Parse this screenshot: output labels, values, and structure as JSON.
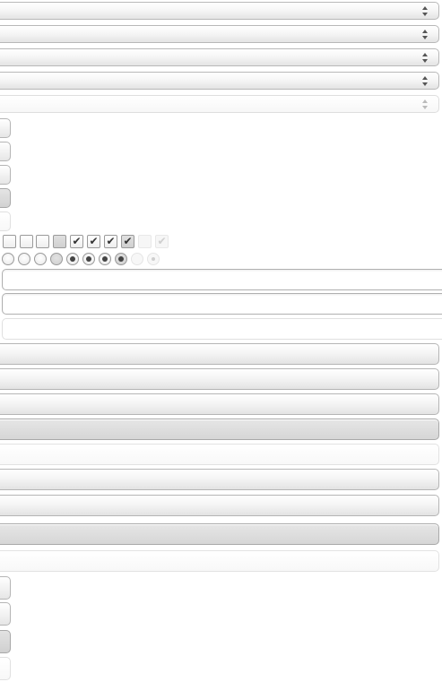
{
  "selects": [
    {
      "state": "normal"
    },
    {
      "state": "normal"
    },
    {
      "state": "pressed"
    },
    {
      "state": "normal"
    },
    {
      "state": "disabled"
    }
  ],
  "stub_buttons": [
    {
      "state": "normal"
    },
    {
      "state": "normal"
    },
    {
      "state": "normal"
    },
    {
      "state": "pressed"
    },
    {
      "state": "disabled"
    }
  ],
  "checkboxes": [
    {
      "checked": false,
      "state": "normal"
    },
    {
      "checked": false,
      "state": "normal"
    },
    {
      "checked": false,
      "state": "normal"
    },
    {
      "checked": false,
      "state": "pressed"
    },
    {
      "checked": true,
      "state": "normal"
    },
    {
      "checked": true,
      "state": "normal"
    },
    {
      "checked": true,
      "state": "normal"
    },
    {
      "checked": true,
      "state": "pressed"
    },
    {
      "checked": false,
      "state": "disabled"
    },
    {
      "checked": true,
      "state": "disabled"
    }
  ],
  "check_glyph": "✔",
  "radios": [
    {
      "checked": false,
      "state": "normal"
    },
    {
      "checked": false,
      "state": "normal"
    },
    {
      "checked": false,
      "state": "normal"
    },
    {
      "checked": false,
      "state": "pressed"
    },
    {
      "checked": true,
      "state": "normal"
    },
    {
      "checked": true,
      "state": "normal"
    },
    {
      "checked": true,
      "state": "normal"
    },
    {
      "checked": true,
      "state": "pressed"
    },
    {
      "checked": false,
      "state": "disabled"
    },
    {
      "checked": true,
      "state": "disabled"
    }
  ],
  "text_fields": [
    {
      "value": "",
      "state": "normal"
    },
    {
      "value": "",
      "state": "focused"
    },
    {
      "value": "",
      "state": "disabled"
    }
  ],
  "wide_buttons": [
    {
      "state": "normal"
    },
    {
      "state": "normal"
    },
    {
      "state": "normal"
    },
    {
      "state": "pressed"
    },
    {
      "state": "disabled"
    },
    {
      "state": "normal"
    },
    {
      "state": "normal"
    },
    {
      "state": "pressed"
    },
    {
      "state": "disabled"
    }
  ],
  "bottom_stubs": [
    {
      "state": "normal"
    },
    {
      "state": "normal"
    },
    {
      "state": "pressed"
    },
    {
      "state": "disabled"
    }
  ]
}
